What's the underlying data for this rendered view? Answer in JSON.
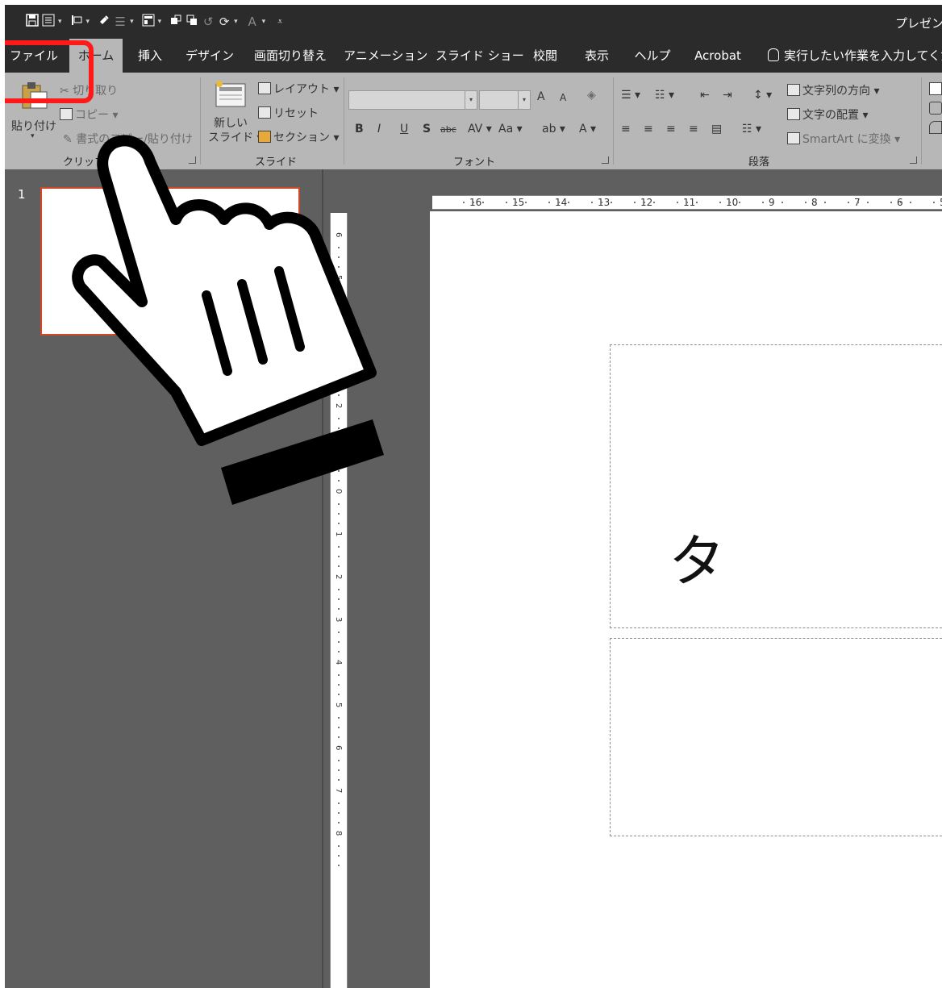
{
  "titlebar": {
    "doc_title": "プレゼンテ",
    "qat_icons": [
      "save-icon",
      "new-slide-qat-icon",
      "start-from-beginning-icon",
      "format-painter-qat-icon",
      "bullets-qat-icon",
      "layout-qat-icon",
      "bring-forward-icon",
      "send-backward-icon",
      "undo-icon",
      "redo-icon",
      "font-color-qat-icon",
      "customize-qat-icon"
    ]
  },
  "tabs": {
    "file": "ファイル",
    "home": "ホーム",
    "insert": "挿入",
    "design": "デザイン",
    "transitions": "画面切り替え",
    "animations": "アニメーション",
    "slideshow": "スライド ショー",
    "review": "校閲",
    "view": "表示",
    "help": "ヘルプ",
    "acrobat": "Acrobat",
    "tell_me": "実行したい作業を入力してくださ"
  },
  "ribbon": {
    "clipboard": {
      "paste": "貼り付け",
      "cut": "切り取り",
      "copy": "コピー",
      "format_painter": "書式のコピー/貼り付け",
      "label": "クリップボード"
    },
    "slides": {
      "new_slide_line1": "新しい",
      "new_slide_line2": "スライド",
      "layout": "レイアウト",
      "reset": "リセット",
      "section": "セクション",
      "label": "スライド"
    },
    "font": {
      "bold": "B",
      "italic": "I",
      "underline": "U",
      "shadow": "S",
      "strike": "abc",
      "spacing": "AV",
      "case": "Aa",
      "grow": "A",
      "shrink": "A",
      "highlight": "ab",
      "color": "A",
      "label": "フォント"
    },
    "paragraph": {
      "text_direction": "文字列の方向",
      "align_text": "文字の配置",
      "smartart": "SmartArt に変換",
      "label": "段落"
    }
  },
  "thumbnails": {
    "slide_number": "1"
  },
  "ruler": {
    "h_ticks": [
      "16",
      "15",
      "14",
      "13",
      "12",
      "11",
      "10",
      "9",
      "8",
      "7",
      "6",
      "5"
    ],
    "v_ticks": [
      "6",
      "5",
      "4",
      "3",
      "2",
      "1",
      "0",
      "1",
      "2",
      "3",
      "4",
      "5",
      "6",
      "7",
      "8"
    ]
  },
  "slide": {
    "title_text": "タ"
  },
  "overlay": {
    "highlight_color": "#ff1a1a",
    "hand_icon": "pointing-hand-icon"
  }
}
